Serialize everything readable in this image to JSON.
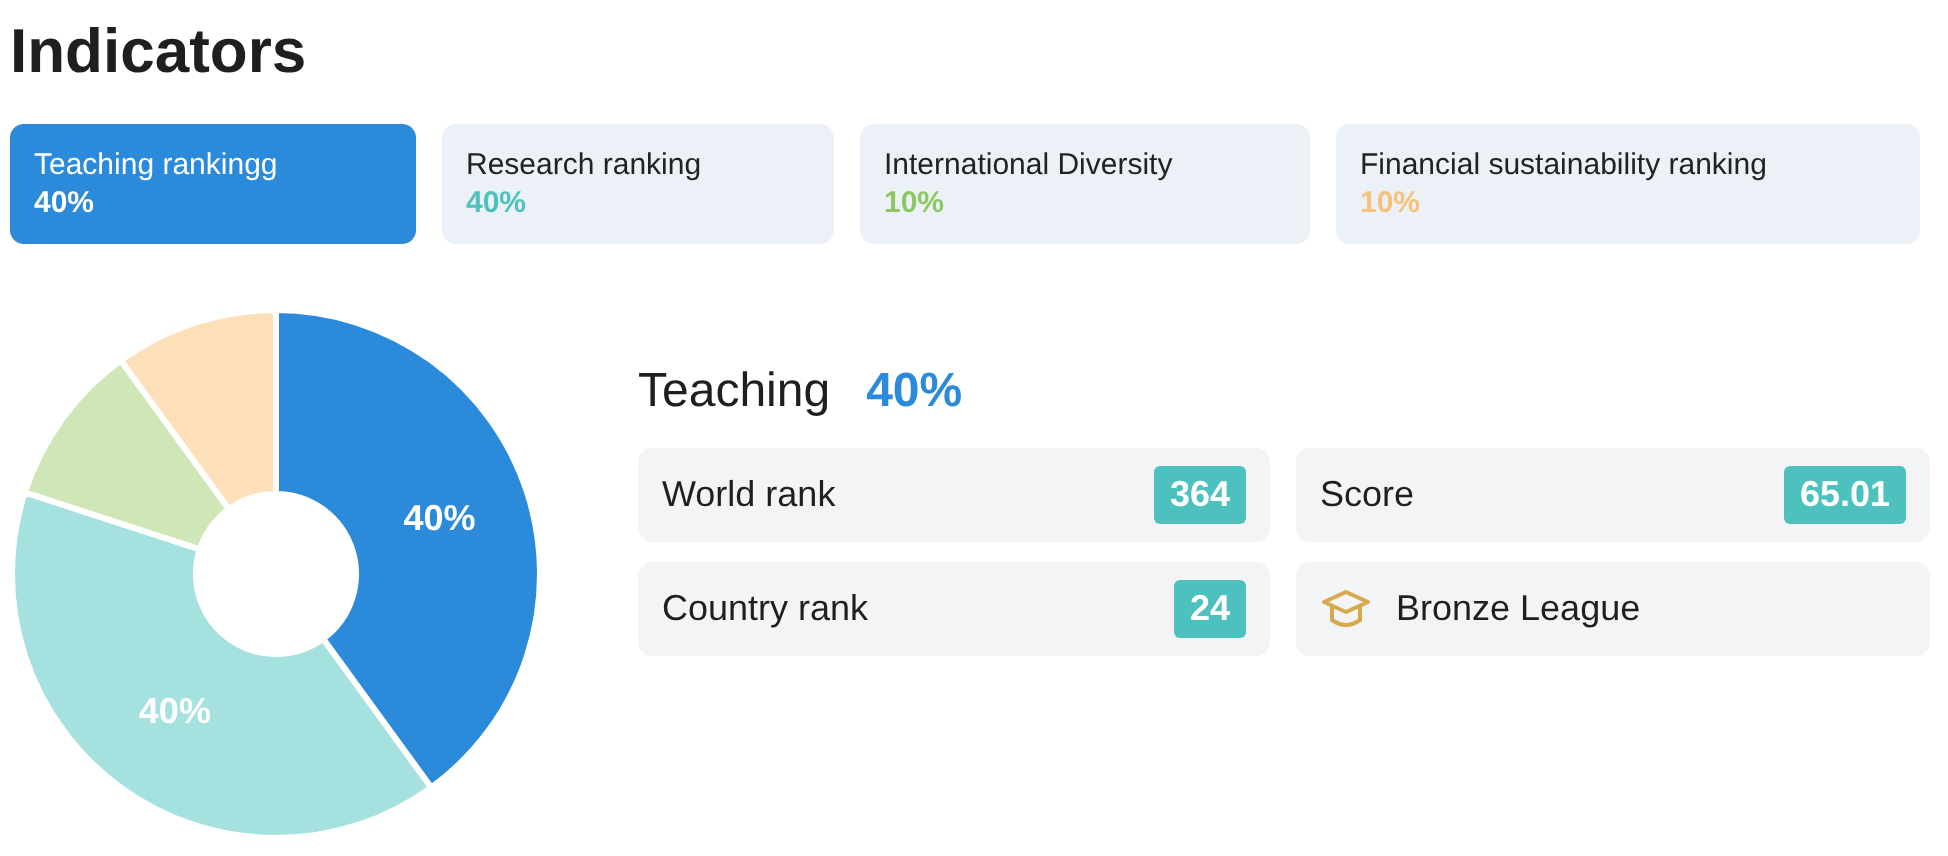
{
  "title": "Indicators",
  "tabs": [
    {
      "label": "Teaching rankingg",
      "percent": "40%",
      "color": "#2b8ad9",
      "selected": true
    },
    {
      "label": "Research ranking",
      "percent": "40%",
      "color": "#4cc1bd",
      "selected": false
    },
    {
      "label": "International Diversity",
      "percent": "10%",
      "color": "#8cc963",
      "selected": false
    },
    {
      "label": "Financial sustainability ranking",
      "percent": "10%",
      "color": "#f7c27a",
      "selected": false
    }
  ],
  "chart_data": {
    "type": "donut",
    "values": [
      40,
      40,
      10,
      10
    ],
    "colors": [
      "#2b8ad9",
      "#a4e1df",
      "#cfe6b6",
      "#fde0b9"
    ],
    "value_labels": [
      "40%",
      "40%",
      null,
      null
    ]
  },
  "detail": {
    "title": "Teaching",
    "percent": "40%",
    "stats": [
      {
        "kind": "value",
        "label": "World rank",
        "value": "364"
      },
      {
        "kind": "value",
        "label": "Score",
        "value": "65.01"
      },
      {
        "kind": "value",
        "label": "Country rank",
        "value": "24"
      },
      {
        "kind": "league",
        "label": "Bronze League"
      }
    ]
  }
}
